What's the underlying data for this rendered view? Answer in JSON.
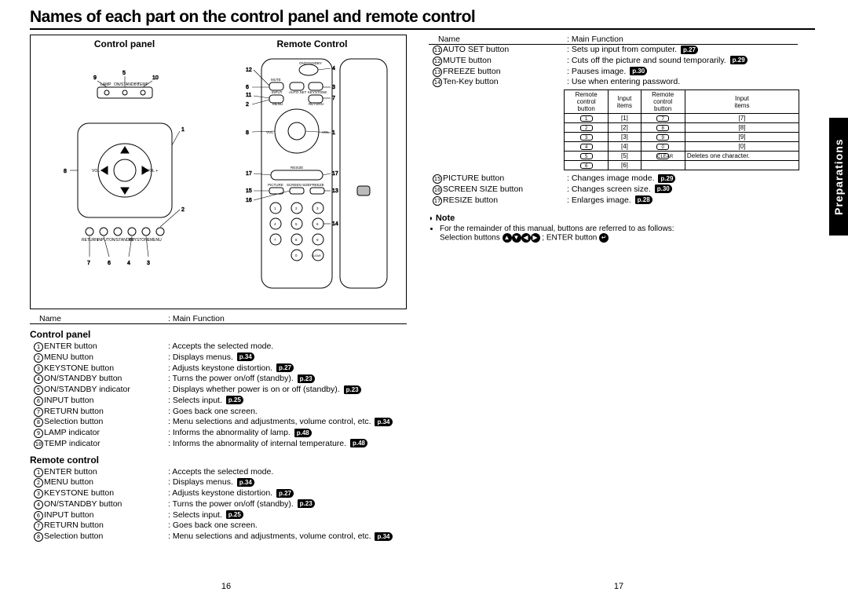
{
  "title": "Names of each part on the control panel and remote control",
  "sidetab": "Preparations",
  "page_left": "16",
  "page_right": "17",
  "diagrams": {
    "control_panel_heading": "Control panel",
    "remote_control_heading": "Remote Control"
  },
  "table_header": {
    "name": "Name",
    "func": "Main Function"
  },
  "sections": {
    "control_panel": {
      "heading": "Control panel",
      "rows": [
        {
          "n": "1",
          "name": "ENTER button",
          "func": "Accepts the selected mode.",
          "pref": ""
        },
        {
          "n": "2",
          "name": "MENU button",
          "func": "Displays menus.",
          "pref": "p.34"
        },
        {
          "n": "3",
          "name": "KEYSTONE button",
          "func": "Adjusts keystone distortion.",
          "pref": "p.27"
        },
        {
          "n": "4",
          "name": "ON/STANDBY button",
          "func": "Turns the power on/off (standby).",
          "pref": "p.23"
        },
        {
          "n": "5",
          "name": "ON/STANDBY indicator",
          "func": "Displays whether power is on or off (standby).",
          "pref": "p.23"
        },
        {
          "n": "6",
          "name": "INPUT button",
          "func": "Selects input.",
          "pref": "p.25"
        },
        {
          "n": "7",
          "name": "RETURN button",
          "func": "Goes back one screen.",
          "pref": ""
        },
        {
          "n": "8",
          "name": "Selection button",
          "func": "Menu selections and adjustments, volume control, etc.",
          "pref": "p.34"
        },
        {
          "n": "9",
          "name": "LAMP indicator",
          "func": "Informs the abnormality of lamp.",
          "pref": "p.48"
        },
        {
          "n": "10",
          "name": "TEMP indicator",
          "func": "Informs the abnormality of internal temperature.",
          "pref": "p.48"
        }
      ]
    },
    "remote_control": {
      "heading": "Remote control",
      "rows": [
        {
          "n": "1",
          "name": "ENTER button",
          "func": "Accepts the selected mode.",
          "pref": ""
        },
        {
          "n": "2",
          "name": "MENU button",
          "func": "Displays menus.",
          "pref": "p.34"
        },
        {
          "n": "3",
          "name": "KEYSTONE button",
          "func": "Adjusts keystone distortion.",
          "pref": "p.27"
        },
        {
          "n": "4",
          "name": "ON/STANDBY button",
          "func": "Turns the power on/off (standby).",
          "pref": "p.23"
        },
        {
          "n": "6",
          "name": "INPUT button",
          "func": "Selects input.",
          "pref": "p.25"
        },
        {
          "n": "7",
          "name": "RETURN button",
          "func": "Goes back one screen.",
          "pref": ""
        },
        {
          "n": "8",
          "name": "Selection button",
          "func": "Menu selections and adjustments, volume control, etc.",
          "pref": "p.34"
        }
      ]
    }
  },
  "right_col": {
    "rows_top": [
      {
        "n": "11",
        "name": "AUTO SET button",
        "func": "Sets up input from computer.",
        "pref": "p.27"
      },
      {
        "n": "12",
        "name": "MUTE button",
        "func": "Cuts off the picture and sound temporarily.",
        "pref": "p.29"
      },
      {
        "n": "13",
        "name": "FREEZE button",
        "func": "Pauses image.",
        "pref": "p.30"
      },
      {
        "n": "14",
        "name": "Ten-Key button",
        "func": "Use when entering password.",
        "pref": ""
      }
    ],
    "rows_bottom": [
      {
        "n": "15",
        "name": "PICTURE button",
        "func": "Changes image mode.",
        "pref": "p.29"
      },
      {
        "n": "16",
        "name": "SCREEN SIZE button",
        "func": "Changes screen size.",
        "pref": "p.30"
      },
      {
        "n": "17",
        "name": "RESIZE button",
        "func": "Enlarges image.",
        "pref": "p.28"
      }
    ],
    "tenkey": {
      "headers": [
        "Remote control button",
        "Input items",
        "Remote control button",
        "Input items"
      ],
      "rows": [
        [
          "1",
          "[1]",
          "7",
          "[7]"
        ],
        [
          "2",
          "[2]",
          "8",
          "[8]"
        ],
        [
          "3",
          "[3]",
          "9",
          "[9]"
        ],
        [
          "4",
          "[4]",
          "0",
          "[0]"
        ],
        [
          "5",
          "[5]",
          "CLEAR",
          "Deletes one character."
        ],
        [
          "6",
          "[6]",
          "",
          ""
        ]
      ]
    },
    "note": {
      "heading": "Note",
      "body": "For the remainder of this manual, buttons are referred to as follows:",
      "line2a": "Selection buttons",
      "line2b": "; ENTER button"
    }
  }
}
